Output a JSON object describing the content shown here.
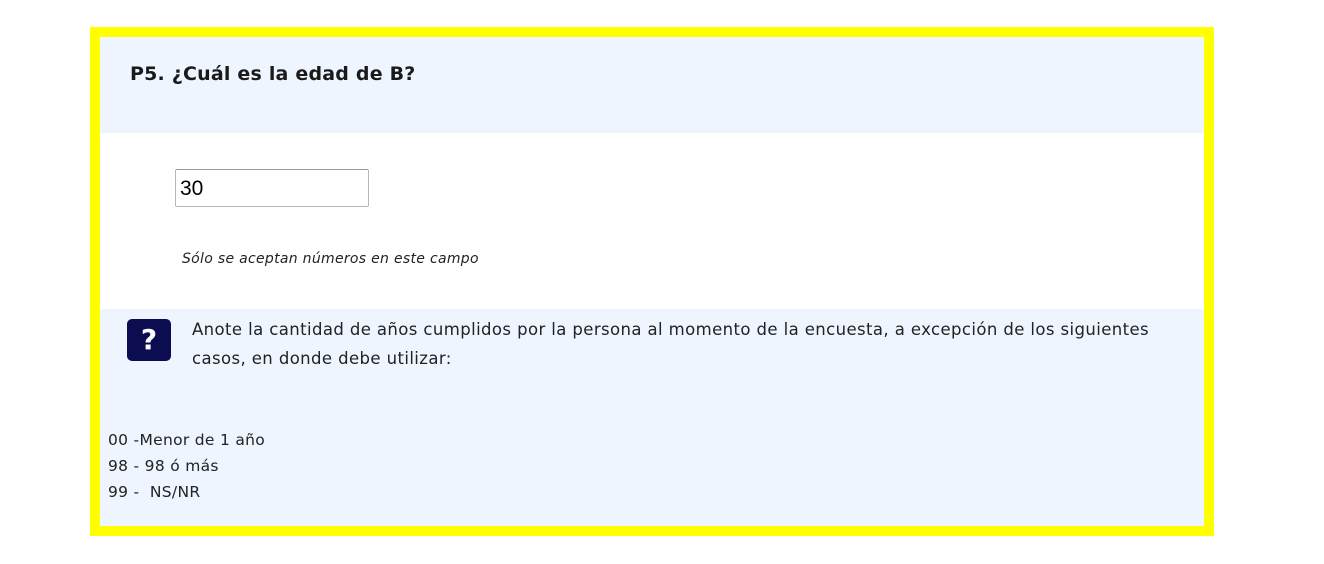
{
  "question": {
    "title": "P5. ¿Cuál es la edad de B?"
  },
  "answer": {
    "value": "30",
    "hint": "Sólo se aceptan números en este campo"
  },
  "help": {
    "icon": "question-icon",
    "icon_glyph": "?",
    "text": "Anote la cantidad de años cumplidos por la persona al momento de la encuesta, a excepción de los siguientes casos, en donde debe utilizar:",
    "codes": [
      "00 -Menor de 1 año",
      "98 - 98 ó más",
      "99 -  NS/NR"
    ]
  },
  "colors": {
    "border": "#ffff00",
    "panel": "#eef5fe",
    "icon_bg": "#0c0c50"
  }
}
